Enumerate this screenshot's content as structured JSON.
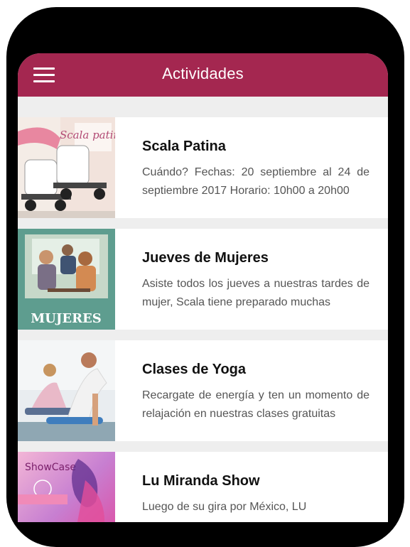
{
  "header": {
    "title": "Actividades"
  },
  "activities": [
    {
      "title": "Scala Patina",
      "description": "Cuándo? Fechas: 20 septiembre al 24 de septiembre 2017 Horario: 10h00 a 20h00",
      "thumb_text": "Scala patina"
    },
    {
      "title": "Jueves de Mujeres",
      "description": "Asiste todos los jueves a nuestras tardes de mujer, Scala tiene preparado muchas",
      "thumb_text": "MUJERES"
    },
    {
      "title": "Clases de Yoga",
      "description": "Recargate de energía y ten un momento de relajación en nuestras clases gratuitas"
    },
    {
      "title": "Lu Miranda Show",
      "description": "Luego de su gira por México, LU",
      "thumb_text": "ShowCase"
    }
  ],
  "colors": {
    "app_bar": "#a42750",
    "background": "#eeeeee"
  }
}
